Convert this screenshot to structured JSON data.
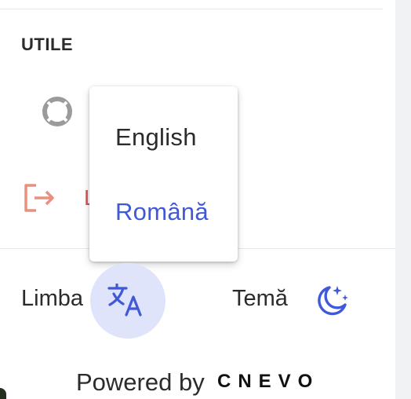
{
  "section": {
    "heading": "UTILE"
  },
  "logout": {
    "label": "L"
  },
  "language_menu": {
    "options": [
      {
        "label": "English",
        "selected": false
      },
      {
        "label": "Română",
        "selected": true
      }
    ]
  },
  "footer": {
    "language_label": "Limba",
    "theme_label": "Temă",
    "powered_by": "Powered by",
    "brand": "CNEVO"
  },
  "icons": {
    "support": "lifebuoy-icon",
    "logout": "logout-icon",
    "translate": "translate-icon",
    "theme": "moon-stars-icon"
  },
  "colors": {
    "accent": "#3f59d8",
    "accent_soft": "#dfe4fb",
    "danger": "#d9534f",
    "text": "#2b2b2b"
  }
}
